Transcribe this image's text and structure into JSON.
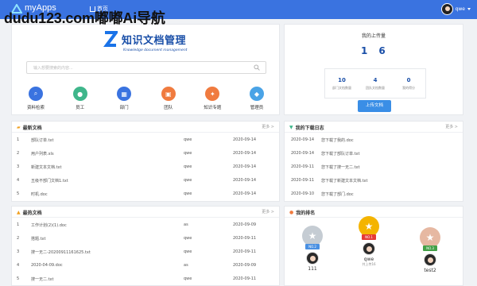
{
  "watermark": "dudu123.com嘟嘟Ai导航",
  "header": {
    "app_name": "myApps",
    "nav_home": "首页",
    "user_name": "qwe"
  },
  "hero": {
    "brand_title": "知识文档管理",
    "brand_subtitle": "Knowledge document management",
    "search_placeholder": "输入想要搜索的内容...",
    "quick_links": [
      {
        "label": "资料检索",
        "color": "#3a73e0",
        "icon": "search-icon"
      },
      {
        "label": "员工",
        "color": "#3fb68b",
        "icon": "person-icon"
      },
      {
        "label": "部门",
        "color": "#3a73e0",
        "icon": "department-icon"
      },
      {
        "label": "团队",
        "color": "#f07b3f",
        "icon": "team-icon"
      },
      {
        "label": "知识专题",
        "color": "#f07b3f",
        "icon": "bulb-icon"
      },
      {
        "label": "管理员",
        "color": "#4aa3e6",
        "icon": "tag-icon"
      }
    ]
  },
  "upload": {
    "title": "我的上传量",
    "digits": [
      "1",
      "6"
    ],
    "stats": [
      {
        "value": "10",
        "label": "部门文档数量"
      },
      {
        "value": "4",
        "label": "团队文档数量"
      },
      {
        "value": "0",
        "label": "我的得分"
      }
    ],
    "button": "上传文档"
  },
  "recent": {
    "title": "最新文档",
    "more": "更多 >",
    "rows": [
      {
        "n": "1",
        "name": "部队订单.txt",
        "user": "qwe",
        "date": "2020-09-14"
      },
      {
        "n": "2",
        "name": "用户列表.xls",
        "user": "qwe",
        "date": "2020-09-14"
      },
      {
        "n": "3",
        "name": "新建文本文档.txt",
        "user": "qwe",
        "date": "2020-09-14"
      },
      {
        "n": "4",
        "name": "五级不部门文档1.txt",
        "user": "qwe",
        "date": "2020-09-14"
      },
      {
        "n": "5",
        "name": "时机.doc",
        "user": "qwe",
        "date": "2020-09-14"
      }
    ]
  },
  "mydl": {
    "title": "我的下载日志",
    "more": "更多 >",
    "rows": [
      {
        "date": "2020-09-14",
        "text": "您下载了我的.doc"
      },
      {
        "date": "2020-09-14",
        "text": "您下载了部队订单.txt"
      },
      {
        "date": "2020-09-11",
        "text": "您下载了搜一无二.txt"
      },
      {
        "date": "2020-09-11",
        "text": "您下载了新建文本文档.txt"
      },
      {
        "date": "2020-09-10",
        "text": "您下载了部门.doc"
      }
    ]
  },
  "hot": {
    "title": "最热文档",
    "more": "更多 >",
    "rows": [
      {
        "n": "1",
        "name": "工作计划(2)(1).doc",
        "user": "as",
        "date": "2020-09-09"
      },
      {
        "n": "2",
        "name": "搭题.txt",
        "user": "qwe",
        "date": "2020-09-11"
      },
      {
        "n": "3",
        "name": "搜一无二-20200911161625.txt",
        "user": "qwe",
        "date": "2020-09-11"
      },
      {
        "n": "4",
        "name": "2020-04-09.doc",
        "user": "as",
        "date": "2020-09-09"
      },
      {
        "n": "5",
        "name": "搜一无二.txt",
        "user": "qwe",
        "date": "2020-09-11"
      }
    ]
  },
  "rank": {
    "title": "我的排名",
    "podium": [
      {
        "badge": "NO.2",
        "name": "111",
        "sub": "",
        "color": "#9aa3ad",
        "ribbon": "#4a90e2"
      },
      {
        "badge": "NO.1",
        "name": "qwe",
        "sub": "共上传16",
        "color": "#f4b400",
        "ribbon": "#e53935"
      },
      {
        "badge": "NO.3",
        "name": "test2",
        "sub": "",
        "color": "#d9a58a",
        "ribbon": "#43a047"
      }
    ]
  }
}
